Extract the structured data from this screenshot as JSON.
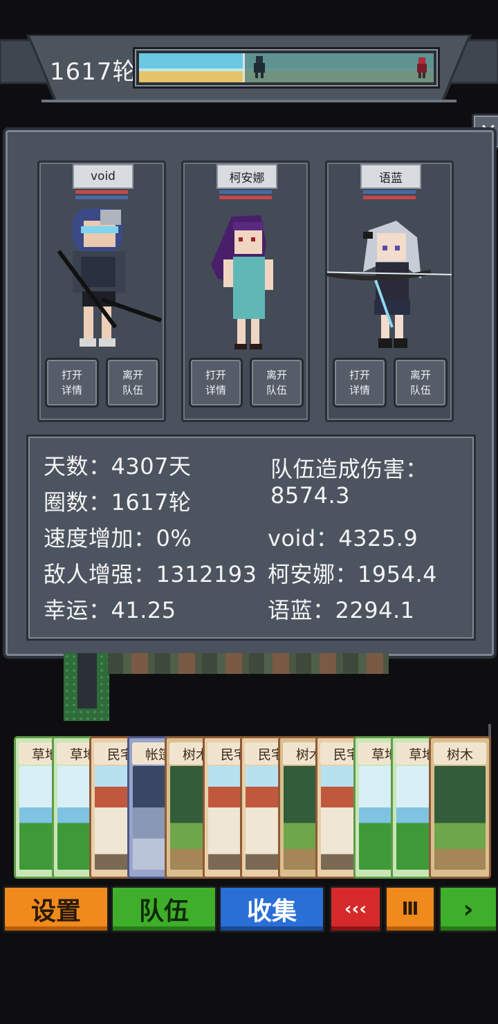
{
  "header": {
    "round_label": "1617轮",
    "progress_fraction": 0.36
  },
  "close_label": "✕",
  "party": [
    {
      "name": "void",
      "open_label_1": "打开",
      "open_label_2": "详情",
      "leave_label_1": "离开",
      "leave_label_2": "队伍"
    },
    {
      "name": "柯安娜",
      "open_label_1": "打开",
      "open_label_2": "详情",
      "leave_label_1": "离开",
      "leave_label_2": "队伍"
    },
    {
      "name": "语蓝",
      "open_label_1": "打开",
      "open_label_2": "详情",
      "leave_label_1": "离开",
      "leave_label_2": "队伍"
    }
  ],
  "stats": {
    "days": "天数：4307天",
    "laps": "圈数：1617轮",
    "speed": "速度增加：0%",
    "enemy": "敌人增强：1312193",
    "luck": "幸运：41.25",
    "damage_title": "队伍造成伤害：",
    "damage_total": "8574.3",
    "dmg_void": "void：4325.9",
    "dmg_kean": "柯安娜：1954.4",
    "dmg_yulan": "语蓝：2294.1"
  },
  "cards": [
    {
      "label": "草地",
      "kind": "grass"
    },
    {
      "label": "草地",
      "kind": "grass"
    },
    {
      "label": "民宅",
      "kind": "house"
    },
    {
      "label": "帐篷",
      "kind": "camp"
    },
    {
      "label": "树木",
      "kind": "tree"
    },
    {
      "label": "民宅",
      "kind": "house"
    },
    {
      "label": "民宅",
      "kind": "house"
    },
    {
      "label": "树木",
      "kind": "tree"
    },
    {
      "label": "民宅",
      "kind": "house"
    },
    {
      "label": "草地",
      "kind": "grass"
    },
    {
      "label": "草地",
      "kind": "grass"
    },
    {
      "label": "树木",
      "kind": "tree"
    }
  ],
  "buttons": {
    "settings": "设置",
    "team": "队伍",
    "collect": "收集",
    "rewind": "‹‹‹",
    "pause": "Ⅲ",
    "play": "›"
  },
  "colors": {
    "panel": "#4a525e",
    "orange": "#f08a1c",
    "green": "#3fae2a",
    "blue": "#2a6fd6",
    "red": "#d62a2a"
  }
}
